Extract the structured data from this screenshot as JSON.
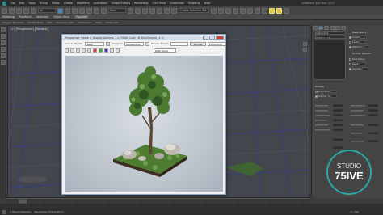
{
  "menubar": {
    "items": [
      "File",
      "Edit",
      "Tools",
      "Group",
      "Views",
      "Create",
      "Modifiers",
      "Animation",
      "Graph Editors",
      "Rendering",
      "Civil View",
      "Customize",
      "Scripting",
      "Help"
    ],
    "window_title": "Autodesk 3ds Max 2015"
  },
  "toolbar": {
    "selection_filter": "All",
    "ref_coord": "View",
    "named_sel": "Create Selection Set"
  },
  "ribbon": {
    "tabs": [
      "Modeling",
      "Freeform",
      "Selection",
      "Object Paint",
      "Populate"
    ],
    "active": "Populate"
  },
  "subtabs": [
    "Polygon Modeling",
    "Modify Mode",
    "Edit",
    "Geometry (All)",
    "Subdivision",
    "Align",
    "Properties"
  ],
  "viewport": {
    "label": "[+] [Perspective] [Realistic]"
  },
  "render_window": {
    "title": "Perspective, frame 0, Display Gamma: 2.2, RGBA Color 16 Bits/Channel (1:1)",
    "area_label": "Area to Render:",
    "area_value": "View",
    "viewport_label": "Viewport:",
    "viewport_value": "Perspective",
    "preset_label": "Render Preset:",
    "render_button": "Render",
    "production_label": "Production",
    "channel_value": "RGB Alpha"
  },
  "command_panel": {
    "object_name": "Scatter001",
    "modifier_list": "Modifier List",
    "rollouts": [
      "Parameters",
      "Scatter Objects",
      "Display"
    ],
    "fields": [
      {
        "label": "Count:",
        "checked": true
      },
      {
        "label": "Scale:",
        "checked": false
      },
      {
        "label": "Rotation:",
        "checked": true
      },
      {
        "label": "Distribution",
        "checked": false
      },
      {
        "label": "Seed:",
        "checked": false
      },
      {
        "label": "Density:",
        "checked": true
      },
      {
        "label": "Animation",
        "checked": false
      },
      {
        "label": "Display %",
        "checked": true
      }
    ]
  },
  "statusbar": {
    "selection": "1 Object Selected",
    "prompt": "Rendering Time 0:00:14",
    "frame": "0 / 100"
  },
  "logo": {
    "line1": "STUDIO",
    "line2": "75IVE"
  },
  "colors": {
    "accent_yellow": "#d9c63b",
    "viewport_bg": "#44464e",
    "grid_line": "#2e3a7a",
    "foliage": "#3f6b2c",
    "grass": "#5a8a3a",
    "logo_bg": "#2aa7a8"
  }
}
